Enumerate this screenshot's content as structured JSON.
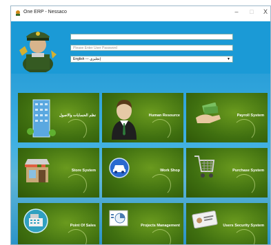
{
  "window": {
    "title": "One ERP - Nessaco",
    "minimize": "–",
    "maximize": "□",
    "close": "X"
  },
  "login": {
    "username_placeholder": "",
    "password_placeholder": "Please Enter User Password",
    "language_selected": "English --- إنجليزي"
  },
  "tiles": [
    {
      "label": "نظم الحسابات والاصول",
      "icon": "building-icon"
    },
    {
      "label": "Human Resource",
      "icon": "person-icon"
    },
    {
      "label": "Payroll System",
      "icon": "money-hand-icon"
    },
    {
      "label": "Store System",
      "icon": "store-icon"
    },
    {
      "label": "Work Shop",
      "icon": "car-icon"
    },
    {
      "label": "Purchase System",
      "icon": "cart-icon"
    },
    {
      "label": "Point Of Sales",
      "icon": "cash-register-icon"
    },
    {
      "label": "Projects Management",
      "icon": "chart-icon"
    },
    {
      "label": "Users Security System",
      "icon": "id-card-icon"
    }
  ],
  "colors": {
    "titlebar": "#ffffff",
    "background": "#1ea0dc",
    "tile_green": "#4f7f14"
  }
}
